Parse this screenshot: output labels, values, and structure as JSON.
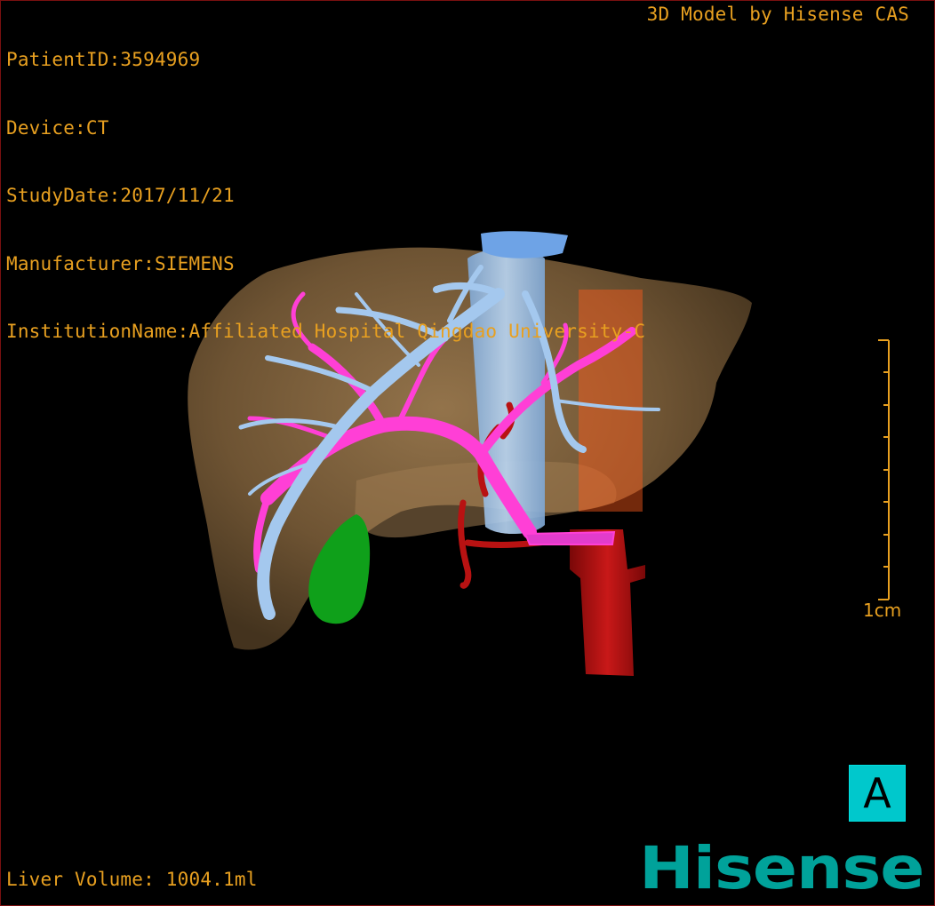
{
  "header": {
    "patient_id": "PatientID:3594969",
    "device": "Device:CT",
    "study_date": "StudyDate:2017/11/21",
    "manufacturer": "Manufacturer:SIEMENS",
    "institution": "InstitutionName:Affiliated Hospital Qingdao University-C"
  },
  "credit": "3D Model by Hisense CAS",
  "footer": {
    "liver_volume": "Liver Volume: 1004.1ml"
  },
  "scale": {
    "label": "1cm"
  },
  "orientation": {
    "label": "A"
  },
  "brand": {
    "logo_text": "Hisense"
  },
  "colors": {
    "overlay_text": "#e8a020",
    "liver": "#8a6a42",
    "hepatic_vein": "#9ec4ea",
    "portal_vein": "#ff3fd6",
    "artery": "#b81212",
    "gallbladder": "#0fa01a",
    "orientation_box": "#00c8cc",
    "brand": "#00a29a"
  }
}
